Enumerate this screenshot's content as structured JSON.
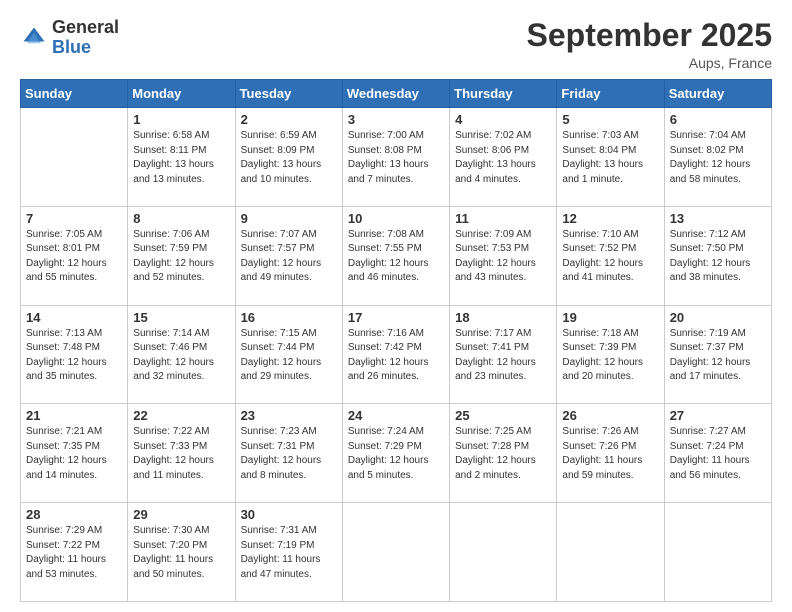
{
  "header": {
    "logo_line1": "General",
    "logo_line2": "Blue",
    "month": "September 2025",
    "location": "Aups, France"
  },
  "days_of_week": [
    "Sunday",
    "Monday",
    "Tuesday",
    "Wednesday",
    "Thursday",
    "Friday",
    "Saturday"
  ],
  "weeks": [
    [
      {
        "day": "",
        "sunrise": "",
        "sunset": "",
        "daylight": ""
      },
      {
        "day": "1",
        "sunrise": "Sunrise: 6:58 AM",
        "sunset": "Sunset: 8:11 PM",
        "daylight": "Daylight: 13 hours and 13 minutes."
      },
      {
        "day": "2",
        "sunrise": "Sunrise: 6:59 AM",
        "sunset": "Sunset: 8:09 PM",
        "daylight": "Daylight: 13 hours and 10 minutes."
      },
      {
        "day": "3",
        "sunrise": "Sunrise: 7:00 AM",
        "sunset": "Sunset: 8:08 PM",
        "daylight": "Daylight: 13 hours and 7 minutes."
      },
      {
        "day": "4",
        "sunrise": "Sunrise: 7:02 AM",
        "sunset": "Sunset: 8:06 PM",
        "daylight": "Daylight: 13 hours and 4 minutes."
      },
      {
        "day": "5",
        "sunrise": "Sunrise: 7:03 AM",
        "sunset": "Sunset: 8:04 PM",
        "daylight": "Daylight: 13 hours and 1 minute."
      },
      {
        "day": "6",
        "sunrise": "Sunrise: 7:04 AM",
        "sunset": "Sunset: 8:02 PM",
        "daylight": "Daylight: 12 hours and 58 minutes."
      }
    ],
    [
      {
        "day": "7",
        "sunrise": "Sunrise: 7:05 AM",
        "sunset": "Sunset: 8:01 PM",
        "daylight": "Daylight: 12 hours and 55 minutes."
      },
      {
        "day": "8",
        "sunrise": "Sunrise: 7:06 AM",
        "sunset": "Sunset: 7:59 PM",
        "daylight": "Daylight: 12 hours and 52 minutes."
      },
      {
        "day": "9",
        "sunrise": "Sunrise: 7:07 AM",
        "sunset": "Sunset: 7:57 PM",
        "daylight": "Daylight: 12 hours and 49 minutes."
      },
      {
        "day": "10",
        "sunrise": "Sunrise: 7:08 AM",
        "sunset": "Sunset: 7:55 PM",
        "daylight": "Daylight: 12 hours and 46 minutes."
      },
      {
        "day": "11",
        "sunrise": "Sunrise: 7:09 AM",
        "sunset": "Sunset: 7:53 PM",
        "daylight": "Daylight: 12 hours and 43 minutes."
      },
      {
        "day": "12",
        "sunrise": "Sunrise: 7:10 AM",
        "sunset": "Sunset: 7:52 PM",
        "daylight": "Daylight: 12 hours and 41 minutes."
      },
      {
        "day": "13",
        "sunrise": "Sunrise: 7:12 AM",
        "sunset": "Sunset: 7:50 PM",
        "daylight": "Daylight: 12 hours and 38 minutes."
      }
    ],
    [
      {
        "day": "14",
        "sunrise": "Sunrise: 7:13 AM",
        "sunset": "Sunset: 7:48 PM",
        "daylight": "Daylight: 12 hours and 35 minutes."
      },
      {
        "day": "15",
        "sunrise": "Sunrise: 7:14 AM",
        "sunset": "Sunset: 7:46 PM",
        "daylight": "Daylight: 12 hours and 32 minutes."
      },
      {
        "day": "16",
        "sunrise": "Sunrise: 7:15 AM",
        "sunset": "Sunset: 7:44 PM",
        "daylight": "Daylight: 12 hours and 29 minutes."
      },
      {
        "day": "17",
        "sunrise": "Sunrise: 7:16 AM",
        "sunset": "Sunset: 7:42 PM",
        "daylight": "Daylight: 12 hours and 26 minutes."
      },
      {
        "day": "18",
        "sunrise": "Sunrise: 7:17 AM",
        "sunset": "Sunset: 7:41 PM",
        "daylight": "Daylight: 12 hours and 23 minutes."
      },
      {
        "day": "19",
        "sunrise": "Sunrise: 7:18 AM",
        "sunset": "Sunset: 7:39 PM",
        "daylight": "Daylight: 12 hours and 20 minutes."
      },
      {
        "day": "20",
        "sunrise": "Sunrise: 7:19 AM",
        "sunset": "Sunset: 7:37 PM",
        "daylight": "Daylight: 12 hours and 17 minutes."
      }
    ],
    [
      {
        "day": "21",
        "sunrise": "Sunrise: 7:21 AM",
        "sunset": "Sunset: 7:35 PM",
        "daylight": "Daylight: 12 hours and 14 minutes."
      },
      {
        "day": "22",
        "sunrise": "Sunrise: 7:22 AM",
        "sunset": "Sunset: 7:33 PM",
        "daylight": "Daylight: 12 hours and 11 minutes."
      },
      {
        "day": "23",
        "sunrise": "Sunrise: 7:23 AM",
        "sunset": "Sunset: 7:31 PM",
        "daylight": "Daylight: 12 hours and 8 minutes."
      },
      {
        "day": "24",
        "sunrise": "Sunrise: 7:24 AM",
        "sunset": "Sunset: 7:29 PM",
        "daylight": "Daylight: 12 hours and 5 minutes."
      },
      {
        "day": "25",
        "sunrise": "Sunrise: 7:25 AM",
        "sunset": "Sunset: 7:28 PM",
        "daylight": "Daylight: 12 hours and 2 minutes."
      },
      {
        "day": "26",
        "sunrise": "Sunrise: 7:26 AM",
        "sunset": "Sunset: 7:26 PM",
        "daylight": "Daylight: 11 hours and 59 minutes."
      },
      {
        "day": "27",
        "sunrise": "Sunrise: 7:27 AM",
        "sunset": "Sunset: 7:24 PM",
        "daylight": "Daylight: 11 hours and 56 minutes."
      }
    ],
    [
      {
        "day": "28",
        "sunrise": "Sunrise: 7:29 AM",
        "sunset": "Sunset: 7:22 PM",
        "daylight": "Daylight: 11 hours and 53 minutes."
      },
      {
        "day": "29",
        "sunrise": "Sunrise: 7:30 AM",
        "sunset": "Sunset: 7:20 PM",
        "daylight": "Daylight: 11 hours and 50 minutes."
      },
      {
        "day": "30",
        "sunrise": "Sunrise: 7:31 AM",
        "sunset": "Sunset: 7:19 PM",
        "daylight": "Daylight: 11 hours and 47 minutes."
      },
      {
        "day": "",
        "sunrise": "",
        "sunset": "",
        "daylight": ""
      },
      {
        "day": "",
        "sunrise": "",
        "sunset": "",
        "daylight": ""
      },
      {
        "day": "",
        "sunrise": "",
        "sunset": "",
        "daylight": ""
      },
      {
        "day": "",
        "sunrise": "",
        "sunset": "",
        "daylight": ""
      }
    ]
  ]
}
